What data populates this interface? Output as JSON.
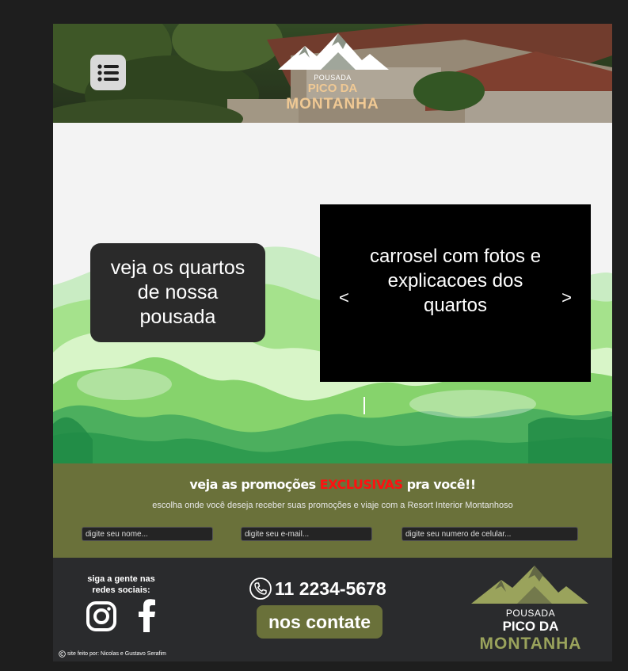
{
  "header": {
    "logo": {
      "line1": "POUSADA",
      "line2": "PICO DA",
      "line3": "MONTANHA"
    },
    "menu_icon": "list-menu-icon"
  },
  "hero": {
    "rooms_text": "veja os quartos de nossa pousada",
    "carousel": {
      "caption": "carrosel com fotos e explicacoes dos quartos",
      "prev": "<",
      "next": ">"
    }
  },
  "promo": {
    "title_before": "veja as promoções ",
    "title_highlight": "EXCLUSIVAS",
    "title_after": " pra você!!",
    "subtitle": "escolha onde você deseja receber suas promoções e viaje com a Resort Interior Montanhoso",
    "fields": {
      "name_placeholder": "digite seu nome...",
      "email_placeholder": "digite seu e-mail...",
      "phone_placeholder": "digite seu numero de celular..."
    }
  },
  "footer": {
    "social_title": "siga a gente nas redes sociais:",
    "phone": "11 2234-5678",
    "contact_button": "nos contate",
    "logo": {
      "line1": "POUSADA",
      "line2": "PICO DA",
      "line3": "MONTANHA"
    },
    "credit": "site feito por: Nicolas e Gustavo Serafim"
  },
  "colors": {
    "page_bg": "#1e1e1e",
    "olive": "#6a713a",
    "footer_bg": "#2a2b2d",
    "gold": "#f0c994",
    "highlight_red": "#ff1010"
  }
}
